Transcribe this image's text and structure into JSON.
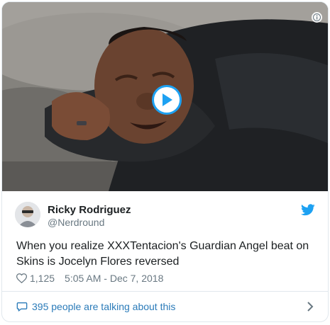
{
  "tweet": {
    "author_name": "Ricky Rodriguez",
    "author_handle": "@Nerdround",
    "text": "When you realize XXXTentacion's Guardian Angel beat on Skins is Jocelyn Flores reversed",
    "likes": "1,125",
    "timestamp": "5:05 AM - Dec 7, 2018",
    "conversation": "395 people are talking about this"
  },
  "icons": {
    "play": "play-icon",
    "info": "info-icon",
    "bird": "twitter-bird-icon",
    "heart": "heart-icon",
    "bubble": "comment-bubble-icon",
    "chevron": "chevron-right-icon"
  },
  "colors": {
    "accent": "#1da1f2",
    "link": "#2b7bb9",
    "muted": "#697882",
    "text": "#1c2022",
    "border": "#e1e8ed"
  }
}
